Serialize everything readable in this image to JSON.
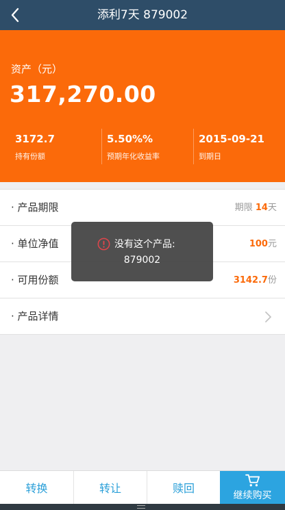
{
  "header": {
    "title": "添利7天 879002"
  },
  "hero": {
    "asset_label": "资产（元）",
    "asset_value": "317,270.00",
    "stats": [
      {
        "value": "3172.7",
        "label": "持有份额"
      },
      {
        "value": "5.50%%",
        "label": "预期年化收益率"
      },
      {
        "value": "2015-09-21",
        "label": "到期日"
      }
    ]
  },
  "rows": {
    "period": {
      "label": "· 产品期限",
      "prefix": "期限",
      "num": "14",
      "unit": "天"
    },
    "nav": {
      "label": "· 单位净值",
      "num": "100",
      "unit": "元"
    },
    "available": {
      "label": "· 可用份额",
      "num": "3142.7",
      "unit": "份"
    },
    "details": {
      "label": "· 产品详情"
    }
  },
  "toast": {
    "line1": "没有这个产品:",
    "line2": "879002"
  },
  "bottom": {
    "convert": "转换",
    "transfer": "转让",
    "redeem": "赎回",
    "buy": "继续购买"
  },
  "colors": {
    "header": "#2e4d68",
    "accent": "#fb6a0a",
    "buy_button": "#2ca4e0",
    "button_text": "#2a9fd8"
  },
  "icons": {
    "back": "back-arrow-icon",
    "chevron": "chevron-right-icon",
    "warning": "warning-icon",
    "cart": "cart-icon"
  }
}
